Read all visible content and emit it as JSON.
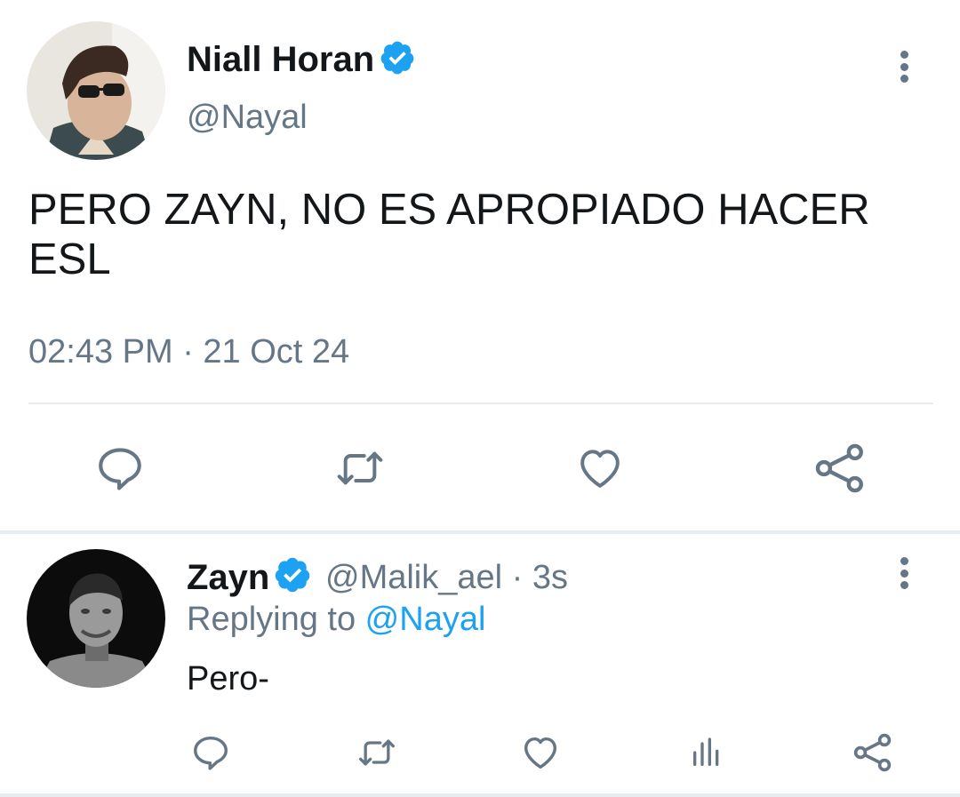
{
  "main_tweet": {
    "author_name": "Niall Horan",
    "handle": "@Nayal",
    "text": "PERO ZAYN, NO ES APROPIADO HACER ESL",
    "timestamp": "02:43 PM · 21 Oct 24",
    "verified": true,
    "actions": [
      "reply-icon",
      "retweet-icon",
      "like-icon",
      "share-icon"
    ]
  },
  "reply_tweet": {
    "author_name": "Zayn",
    "handle": "@Malik_ael",
    "time_sep": " · ",
    "time_ago": "3s",
    "replying_prefix": "Replying to ",
    "replying_handle": "@Nayal",
    "text": "Pero-",
    "verified": true,
    "actions": [
      "reply-icon",
      "retweet-icon",
      "like-icon",
      "analytics-icon",
      "share-icon"
    ]
  },
  "colors": {
    "accent": "#1da1f2",
    "text_primary": "#14171a",
    "text_secondary": "#657786",
    "divider": "#e6ecf0"
  }
}
